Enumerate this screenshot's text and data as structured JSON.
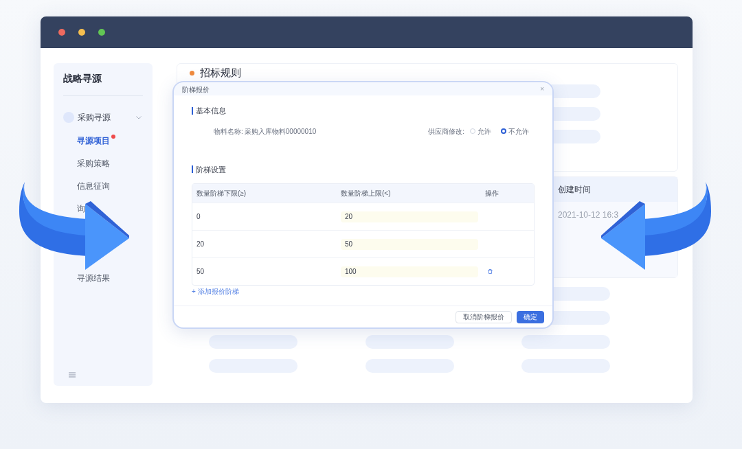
{
  "window": {
    "controls": [
      {
        "color": "#ee6a5f"
      },
      {
        "color": "#f5be4f"
      },
      {
        "color": "#62c554"
      }
    ]
  },
  "sidebar": {
    "title": "战略寻源",
    "group": {
      "label": "采购寻源",
      "expanded": true,
      "items": [
        {
          "label": "寻源项目",
          "selected": true,
          "badge": true
        },
        {
          "label": "采购策略",
          "selected": false,
          "badge": false
        },
        {
          "label": "信息征询",
          "selected": false,
          "badge": false
        },
        {
          "label": "询",
          "selected": false,
          "badge": false
        },
        {
          "label": "寻源结果",
          "selected": false,
          "badge": false
        }
      ]
    }
  },
  "main": {
    "section_title": "招标规则",
    "table": {
      "columns": [
        "创建时间"
      ],
      "rows": [
        [
          "2021-10-12 16:3"
        ]
      ]
    }
  },
  "modal": {
    "title": "阶梯报价",
    "close": "×",
    "basic_info": {
      "title": "基本信息",
      "material_label": "物料名称:",
      "material_value": "采购入库物料00000010",
      "supplier_label": "供应商修改:",
      "options": [
        {
          "label": "允许",
          "selected": false
        },
        {
          "label": "不允许",
          "selected": true
        }
      ]
    },
    "tiers": {
      "title": "阶梯设置",
      "columns": [
        "数量阶梯下限(≥)",
        "数量阶梯上限(<)",
        "操作"
      ],
      "rows": [
        {
          "lower": "0",
          "upper": "20",
          "deletable": false
        },
        {
          "lower": "20",
          "upper": "50",
          "deletable": false
        },
        {
          "lower": "50",
          "upper": "100",
          "deletable": true
        }
      ],
      "add_link": "+ 添加报价阶梯"
    },
    "buttons": [
      {
        "label": "取消阶梯报价",
        "kind": "secondary"
      },
      {
        "label": "确定",
        "kind": "primary"
      }
    ]
  }
}
